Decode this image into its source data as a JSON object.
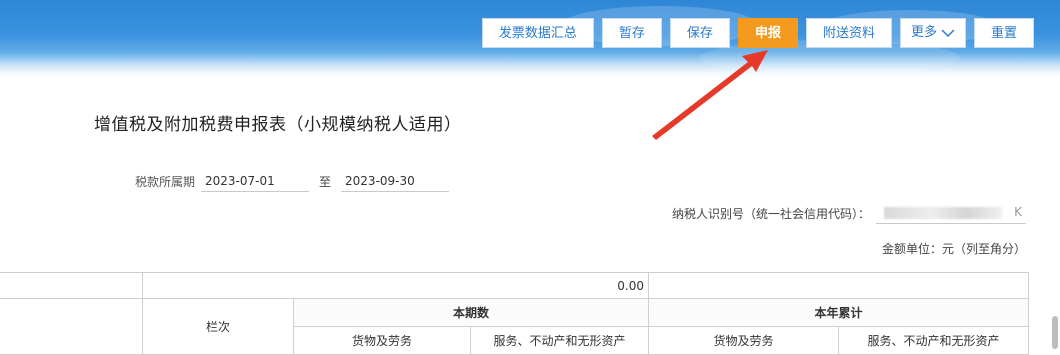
{
  "toolbar": {
    "summary": "发票数据汇总",
    "temp_save": "暂存",
    "save": "保存",
    "declare": "申报",
    "attach": "附送资料",
    "more": "更多",
    "reset": "重置"
  },
  "form": {
    "title": "增值税及附加税费申报表（小规模纳税人适用）",
    "period_label": "税款所属期",
    "period_from": "2023-07-01",
    "period_sep": "至",
    "period_to": "2023-09-30",
    "taxid_label": "纳税人识别号（统一社会信用代码）：",
    "taxid_tail": "K",
    "unit": "金额单位：元（列至角分）"
  },
  "table": {
    "value": "0.00",
    "col_label": "栏次",
    "current_period": "本期数",
    "year_to_date": "本年累计",
    "goods_services": "货物及劳务",
    "services_assets": "服务、不动产和无形资产",
    "goods_services_2": "货物及劳务",
    "services_assets_2": "服务、不动产和无形资产"
  },
  "colors": {
    "accent": "#f39a1f",
    "button_text": "#2a7bcc",
    "banner": "#2f86d6",
    "annotation_arrow": "#e53a2a"
  }
}
